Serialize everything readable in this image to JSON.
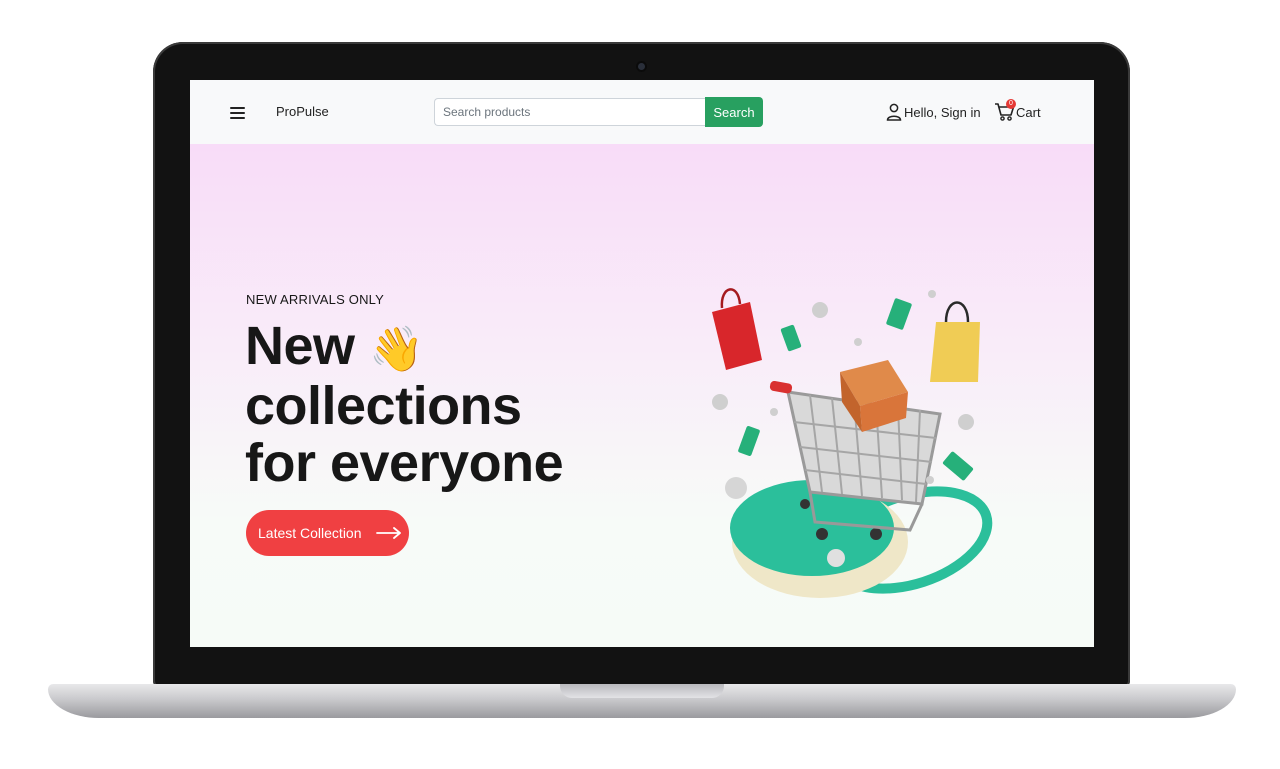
{
  "navbar": {
    "brand": "ProPulse",
    "search_placeholder": "Search products",
    "search_button": "Search",
    "signin_label": "Hello, Sign in",
    "cart_label": "Cart",
    "cart_count": "0"
  },
  "hero": {
    "subtitle": "NEW ARRIVALS ONLY",
    "title_line1": "New",
    "title_emoji": "👋",
    "title_line2": "collections",
    "title_line3": "for everyone",
    "cta_label": "Latest Collection"
  },
  "colors": {
    "accent_green": "#28a060",
    "cta_red": "#f04042",
    "badge_red": "#e53935",
    "hero_top": "#f8dcf8",
    "hero_bottom": "#f6fbf7",
    "teal": "#2bbf9b"
  },
  "icons": [
    "hamburger-icon",
    "user-icon",
    "cart-icon",
    "arrow-right-icon",
    "waving-hand-icon",
    "shopping-cart-illustration"
  ]
}
